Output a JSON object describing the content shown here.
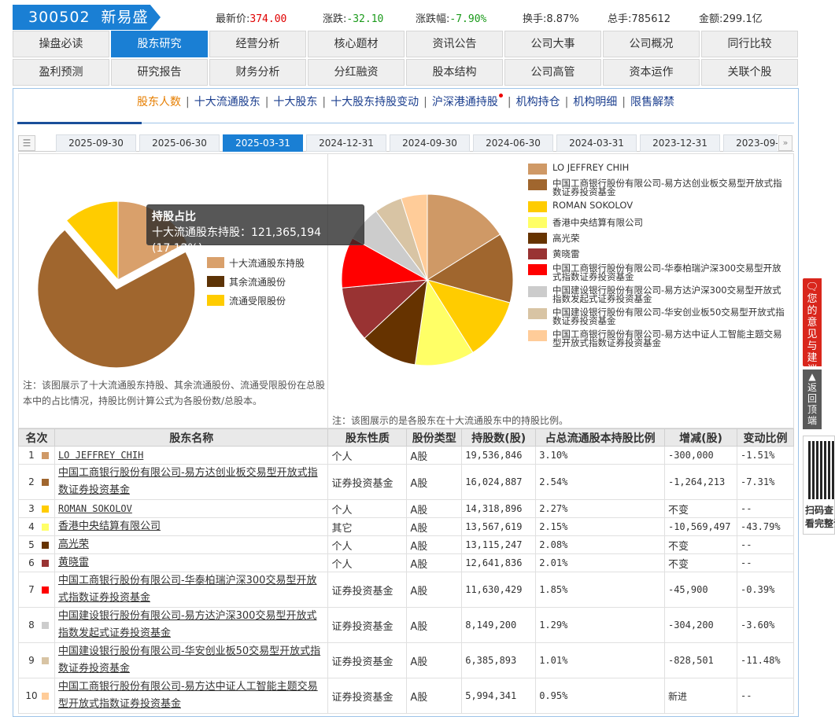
{
  "header": {
    "code": "300502",
    "name": "新易盛",
    "quotes": [
      {
        "label": "最新价:",
        "value": "374.00",
        "style": "red"
      },
      {
        "label": "涨跌:",
        "value": "-32.10",
        "style": "down"
      },
      {
        "label": "涨跌幅:",
        "value": "-7.90%",
        "style": "down"
      },
      {
        "label": "换手:",
        "value": "8.87%",
        "style": "plain"
      },
      {
        "label": "总手:",
        "value": "785612",
        "style": "plain"
      },
      {
        "label": "金额:",
        "value": "299.1亿",
        "style": "plain"
      }
    ]
  },
  "nav": {
    "row1": [
      "操盘必读",
      "股东研究",
      "经营分析",
      "核心题材",
      "资讯公告",
      "公司大事",
      "公司概况",
      "同行比较"
    ],
    "row2": [
      "盈利预测",
      "研究报告",
      "财务分析",
      "分红融资",
      "股本结构",
      "公司高管",
      "资本运作",
      "关联个股"
    ],
    "active": "股东研究"
  },
  "subnav": {
    "items": [
      "股东人数",
      "十大流通股东",
      "十大股东",
      "十大股东持股变动",
      "沪深港通持股",
      "机构持仓",
      "机构明细",
      "限售解禁"
    ],
    "current": "股东人数"
  },
  "date_tabs": {
    "items": [
      "2025-09-30",
      "2025-06-30",
      "2025-03-31",
      "2024-12-31",
      "2024-09-30",
      "2024-06-30",
      "2024-03-31",
      "2023-12-31",
      "2023-09-30"
    ],
    "active": "2025-03-31"
  },
  "left_chart": {
    "legend": [
      {
        "label": "十大流通股东持股",
        "color": "#D9A06B"
      },
      {
        "label": "其余流通股份",
        "color": "#5C3306"
      },
      {
        "label": "流通受限股份",
        "color": "#FFCC00"
      }
    ],
    "note": "注：该图展示了十大流通股东持股、其余流通股份、流通受限股份在总股本中的占比情况，持股比例计算公式为各股份数/总股本。",
    "tooltip": {
      "title": "持股占比",
      "body": "十大流通股东持股：121,365,194 (17.12%)"
    }
  },
  "right_chart": {
    "note": "注：该图展示的是各股东在十大流通股东中的持股比例。"
  },
  "chart_data": [
    {
      "type": "pie",
      "labels": [
        "十大流通股东持股",
        "其余流通股份",
        "流通受限股份"
      ],
      "values": [
        17.12,
        71.5,
        11.38
      ],
      "colors": [
        "#D9A06B",
        "#A0662E",
        "#FFCC00"
      ],
      "exploded": "其余流通股份"
    },
    {
      "type": "pie",
      "labels": [
        "LO JEFFREY CHIH",
        "中国工商银行股份有限公司-易方达创业板交易型开放式指数证券投资基金",
        "ROMAN SOKOLOV",
        "香港中央结算有限公司",
        "高光荣",
        "黄晓雷",
        "中国工商银行股份有限公司-华泰柏瑞沪深300交易型开放式指数证券投资基金",
        "中国建设银行股份有限公司-易方达沪深300交易型开放式指数发起式证券投资基金",
        "中国建设银行股份有限公司-华安创业板50交易型开放式指数证券投资基金",
        "中国工商银行股份有限公司-易方达中证人工智能主题交易型开放式指数证券投资基金"
      ],
      "values": [
        19536846,
        16024887,
        14318896,
        13567619,
        13115247,
        12641836,
        11630429,
        8149200,
        6385893,
        5994341
      ],
      "colors": [
        "#CF9966",
        "#A0662E",
        "#FFCC00",
        "#FFFF66",
        "#663300",
        "#993333",
        "#FF0000",
        "#CCCCCC",
        "#D8C4A4",
        "#FFCC99"
      ]
    }
  ],
  "table": {
    "headers": [
      "名次",
      "股东名称",
      "股东性质",
      "股份类型",
      "持股数(股)",
      "占总流通股本持股比例",
      "增减(股)",
      "变动比例"
    ],
    "rows": [
      {
        "rank": "1",
        "color": "#CF9966",
        "name": "LO JEFFREY CHIH",
        "nature": "个人",
        "type": "A股",
        "shares": "19,536,846",
        "ratio": "3.10%",
        "change": "-300,000",
        "pct": "-1.51%",
        "dir": "dn"
      },
      {
        "rank": "2",
        "color": "#A0662E",
        "name": "中国工商银行股份有限公司-易方达创业板交易型开放式指数证券投资基金",
        "nature": "证券投资基金",
        "type": "A股",
        "shares": "16,024,887",
        "ratio": "2.54%",
        "change": "-1,264,213",
        "pct": "-7.31%",
        "dir": "dn"
      },
      {
        "rank": "3",
        "color": "#FFCC00",
        "name": "ROMAN SOKOLOV",
        "nature": "个人",
        "type": "A股",
        "shares": "14,318,896",
        "ratio": "2.27%",
        "change": "不变",
        "pct": "--",
        "dir": "flat"
      },
      {
        "rank": "4",
        "color": "#FFFF66",
        "name": "香港中央结算有限公司",
        "nature": "其它",
        "type": "A股",
        "shares": "13,567,619",
        "ratio": "2.15%",
        "change": "-10,569,497",
        "pct": "-43.79%",
        "dir": "dn"
      },
      {
        "rank": "5",
        "color": "#663300",
        "name": "高光荣",
        "nature": "个人",
        "type": "A股",
        "shares": "13,115,247",
        "ratio": "2.08%",
        "change": "不变",
        "pct": "--",
        "dir": "flat"
      },
      {
        "rank": "6",
        "color": "#993333",
        "name": "黄晓雷",
        "nature": "个人",
        "type": "A股",
        "shares": "12,641,836",
        "ratio": "2.01%",
        "change": "不变",
        "pct": "--",
        "dir": "flat"
      },
      {
        "rank": "7",
        "color": "#FF0000",
        "name": "中国工商银行股份有限公司-华泰柏瑞沪深300交易型开放式指数证券投资基金",
        "nature": "证券投资基金",
        "type": "A股",
        "shares": "11,630,429",
        "ratio": "1.85%",
        "change": "-45,900",
        "pct": "-0.39%",
        "dir": "dn"
      },
      {
        "rank": "8",
        "color": "#CCCCCC",
        "name": "中国建设银行股份有限公司-易方达沪深300交易型开放式指数发起式证券投资基金",
        "nature": "证券投资基金",
        "type": "A股",
        "shares": "8,149,200",
        "ratio": "1.29%",
        "change": "-304,200",
        "pct": "-3.60%",
        "dir": "dn"
      },
      {
        "rank": "9",
        "color": "#D8C4A4",
        "name": "中国建设银行股份有限公司-华安创业板50交易型开放式指数证券投资基金",
        "nature": "证券投资基金",
        "type": "A股",
        "shares": "6,385,893",
        "ratio": "1.01%",
        "change": "-828,501",
        "pct": "-11.48%",
        "dir": "dn"
      },
      {
        "rank": "10",
        "color": "#FFCC99",
        "name": "中国工商银行股份有限公司-易方达中证人工智能主题交易型开放式指数证券投资基金",
        "nature": "证券投资基金",
        "type": "A股",
        "shares": "5,994,341",
        "ratio": "0.95%",
        "change": "新进",
        "pct": "--",
        "dir": "new"
      }
    ]
  },
  "side": {
    "feedback": "您的意见与建议",
    "totop": "返回顶端",
    "qr_text": "扫码查看完整诊"
  }
}
